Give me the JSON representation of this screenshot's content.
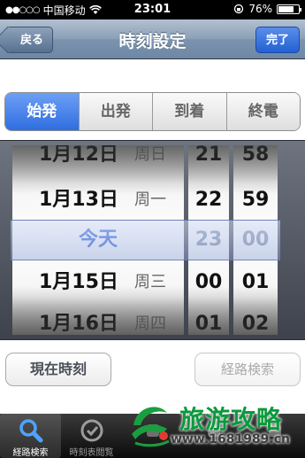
{
  "status_bar": {
    "carrier": "中国移动",
    "time": "23:01",
    "battery": "76%",
    "battery_level": 0.76
  },
  "nav": {
    "back_label": "戻る",
    "title": "時刻設定",
    "done_label": "完了"
  },
  "segments": [
    {
      "label": "始発",
      "active": true
    },
    {
      "label": "出発",
      "active": false
    },
    {
      "label": "到着",
      "active": false
    },
    {
      "label": "終電",
      "active": false
    }
  ],
  "picker": {
    "dates": [
      {
        "date": "1月12日",
        "weekday": "周日"
      },
      {
        "date": "1月13日",
        "weekday": "周一"
      },
      {
        "today": "今天"
      },
      {
        "date": "1月15日",
        "weekday": "周三"
      },
      {
        "date": "1月16日",
        "weekday": "周四"
      }
    ],
    "hours": [
      "21",
      "22",
      "23",
      "00",
      "01"
    ],
    "minutes": [
      "58",
      "59",
      "00",
      "01",
      "02"
    ]
  },
  "buttons": {
    "now_label": "現在時刻",
    "search_label": "経路検索"
  },
  "tabs": [
    {
      "label": "経路検索",
      "icon": "search-icon",
      "active": true
    },
    {
      "label": "時刻表閲覧",
      "icon": "clock-icon",
      "active": false
    },
    {
      "label": "",
      "icon": "tab-icon",
      "active": false
    },
    {
      "label": "",
      "icon": "tab-icon",
      "active": false
    },
    {
      "label": "",
      "icon": "tab-icon",
      "active": false
    }
  ],
  "watermark": {
    "text": "旅游攻略",
    "url": "www.1681989.cn"
  }
}
